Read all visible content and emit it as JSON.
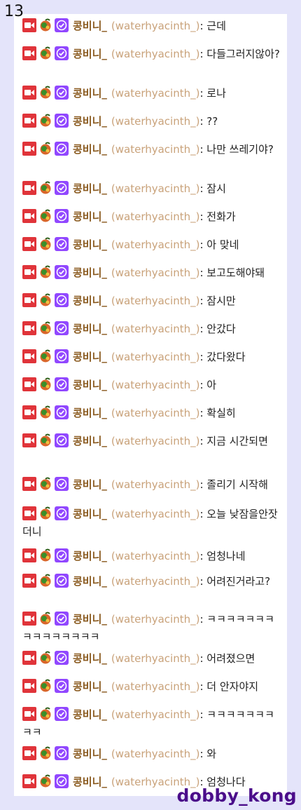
{
  "page_number": "13",
  "watermark": "dobby_kong",
  "colors": {
    "name": "#8a5a1f",
    "login": "#c9a27a",
    "badge_camera": "#e0343a",
    "badge_verified": "#9147ff"
  },
  "badge_icons": [
    "camera-badge-icon",
    "fruit-badge-icon",
    "verified-badge-icon"
  ],
  "user": {
    "display_name": "콩비니_",
    "login": "(waterhyacinth_)"
  },
  "colon": ":",
  "messages": [
    {
      "text": "근데"
    },
    {
      "text": "다들그러지않아?"
    },
    {
      "text": "로나"
    },
    {
      "text": "??"
    },
    {
      "text": "나만 쓰레기야?"
    },
    {
      "text": "잠시"
    },
    {
      "text": "전화가"
    },
    {
      "text": "아 맞네"
    },
    {
      "text": "보고도해야돼"
    },
    {
      "text": "잠시만"
    },
    {
      "text": "안갔다"
    },
    {
      "text": "갔다왔다"
    },
    {
      "text": "아"
    },
    {
      "text": "확실히"
    },
    {
      "text": "지금 시간되면"
    },
    {
      "text": "졸리기 시작해"
    },
    {
      "text": "오늘 낮잠을안잣더니"
    },
    {
      "text": "엄청나네"
    },
    {
      "text": "어려진거라고?"
    },
    {
      "text": "ㅋㅋㅋㅋㅋㅋㅋㅋㅋㅋㅋㅋㅋㅋㅋ"
    },
    {
      "text": "어려졌으면"
    },
    {
      "text": "더 안자야지"
    },
    {
      "text": "ㅋㅋㅋㅋㅋㅋㅋㅋㅋ"
    },
    {
      "text": "와"
    },
    {
      "text": "엄청나다"
    }
  ]
}
